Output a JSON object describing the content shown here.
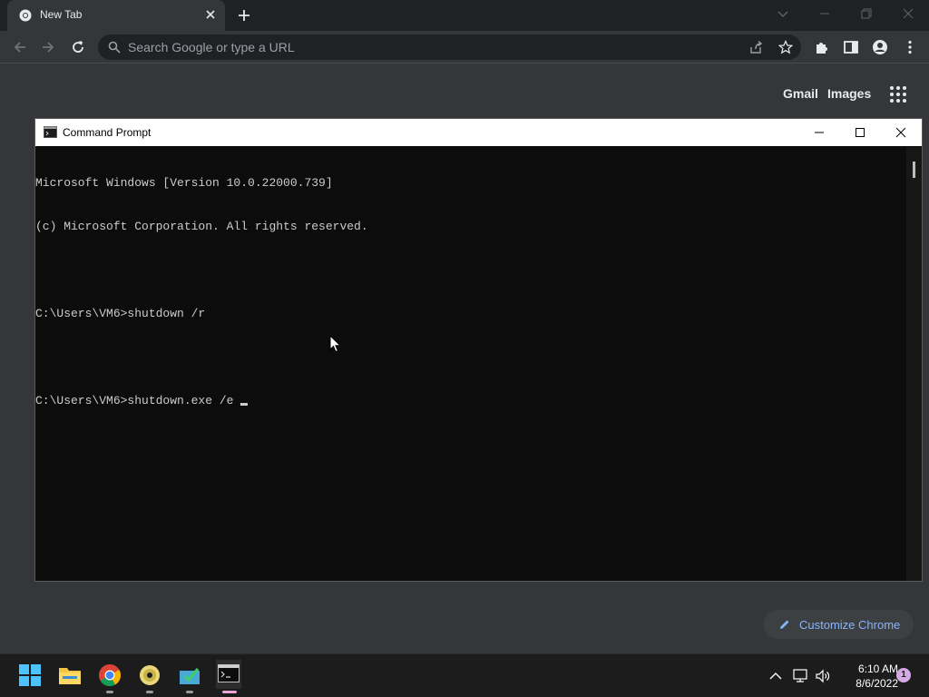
{
  "browser": {
    "tab_title": "New Tab",
    "omnibox_placeholder": "Search Google or type a URL",
    "top_links": {
      "gmail": "Gmail",
      "images": "Images"
    },
    "customize_label": "Customize Chrome"
  },
  "cmd": {
    "title": "Command Prompt",
    "lines": [
      "Microsoft Windows [Version 10.0.22000.739]",
      "(c) Microsoft Corporation. All rights reserved.",
      "",
      "C:\\Users\\VM6>shutdown /r",
      "",
      "C:\\Users\\VM6>shutdown.exe /e "
    ]
  },
  "taskbar": {
    "time": "6:10 AM",
    "date": "8/6/2022",
    "notification_count": "1"
  },
  "colors": {
    "chrome_frame": "#202124",
    "chrome_toolbar": "#35363a",
    "console_bg": "#0c0c0c",
    "console_text": "#cccccc",
    "link_blue": "#8ab4f8",
    "taskbar_bg": "#1c1c1c",
    "active_app_indicator": "#e7a8d6"
  },
  "icons": {
    "tab_favicon": "chrome-icon",
    "start": "windows-start-icon",
    "explorer": "folder-icon",
    "cmd": "console-icon"
  }
}
